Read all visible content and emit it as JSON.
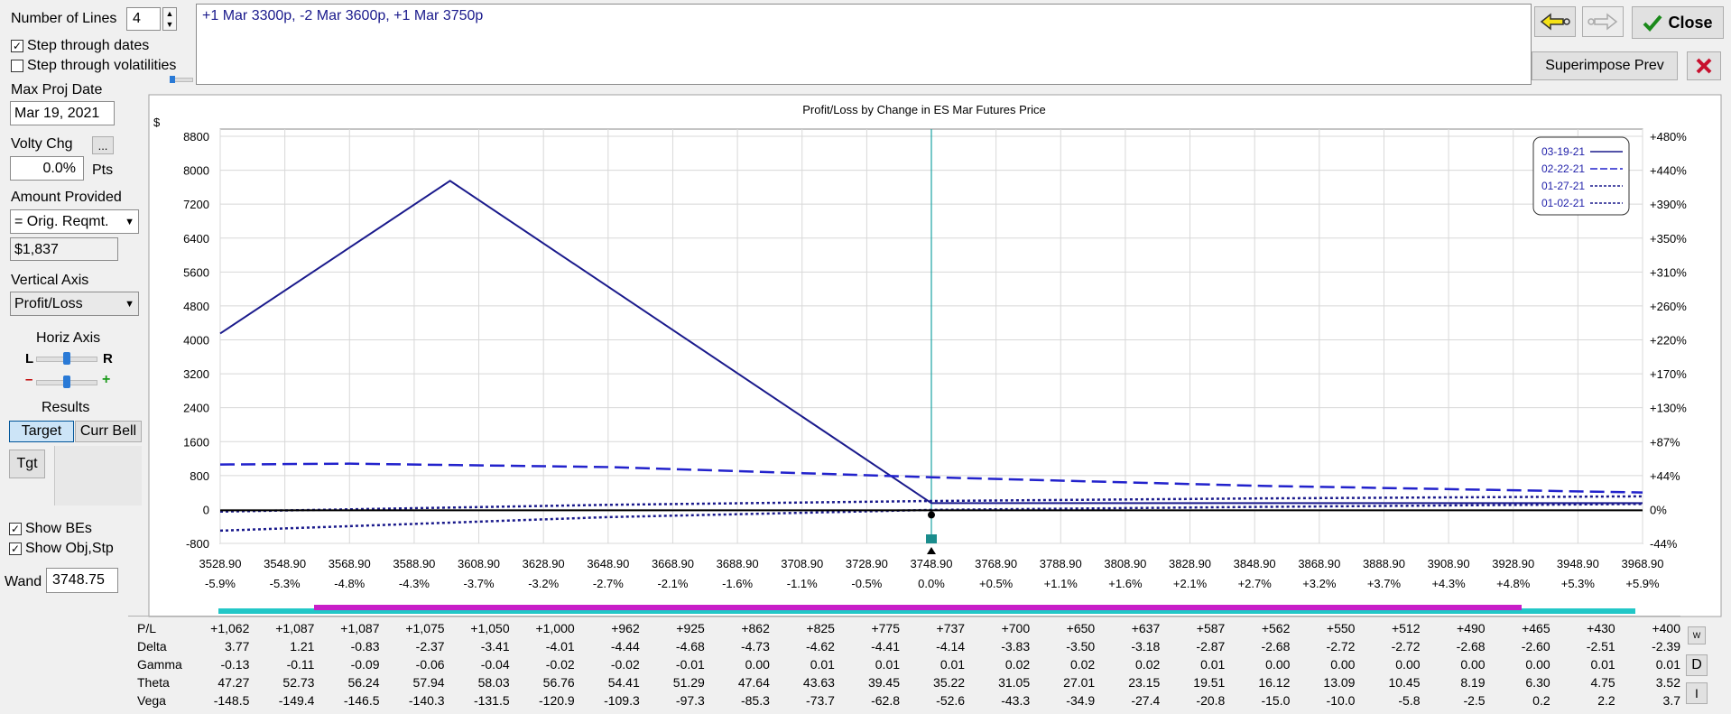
{
  "controls": {
    "number_of_lines_label": "Number of Lines",
    "number_of_lines_value": "4",
    "step_dates_label": "Step through dates",
    "step_dates_checked": true,
    "step_vols_label": "Step through volatilities",
    "step_vols_checked": false,
    "max_proj_date_label": "Max Proj Date",
    "max_proj_date_value": "Mar 19, 2021",
    "volty_chg_label": "Volty Chg",
    "volty_chg_btn": "...",
    "volty_chg_value": "0.0%",
    "volty_chg_unit": "Pts",
    "amount_provided_label": "Amount Provided",
    "amount_provided_select": "= Orig. Reqmt.",
    "amount_value": "$1,837",
    "vertical_axis_label": "Vertical Axis",
    "vertical_axis_select": "Profit/Loss",
    "horiz_axis_label": "Horiz Axis",
    "horiz_l": "L",
    "horiz_r": "R",
    "horiz_minus": "–",
    "horiz_plus": "+",
    "results_label": "Results",
    "target_btn": "Target",
    "curr_bell_btn": "Curr Bell",
    "tgt_btn": "Tgt",
    "show_bes_label": "Show BEs",
    "show_bes_checked": true,
    "show_obj_label": "Show Obj,Stp",
    "show_obj_checked": true,
    "wand_label": "Wand",
    "wand_value": "3748.75"
  },
  "position_text": "+1 Mar 3300p, -2 Mar 3600p, +1 Mar 3750p",
  "toolbar": {
    "back_icon": "arrow-left-icon",
    "forward_icon": "arrow-right-icon",
    "close_label": "Close",
    "close_icon": "checkmark-icon",
    "superimpose_label": "Superimpose Prev",
    "delete_icon": "red-x-icon"
  },
  "chart_data": {
    "type": "line",
    "title": "Profit/Loss by Change in ES Mar Futures Price",
    "yunit_label": "$",
    "x_ticks": [
      "3528.90",
      "3548.90",
      "3568.90",
      "3588.90",
      "3608.90",
      "3628.90",
      "3648.90",
      "3668.90",
      "3688.90",
      "3708.90",
      "3728.90",
      "3748.90",
      "3768.90",
      "3788.90",
      "3808.90",
      "3828.90",
      "3848.90",
      "3868.90",
      "3888.90",
      "3908.90",
      "3928.90",
      "3948.90",
      "3968.90"
    ],
    "x_pct_ticks": [
      "-5.9%",
      "-5.3%",
      "-4.8%",
      "-4.3%",
      "-3.7%",
      "-3.2%",
      "-2.7%",
      "-2.1%",
      "-1.6%",
      "-1.1%",
      "-0.5%",
      "0.0%",
      "+0.5%",
      "+1.1%",
      "+1.6%",
      "+2.1%",
      "+2.7%",
      "+3.2%",
      "+3.7%",
      "+4.3%",
      "+4.8%",
      "+5.3%",
      "+5.9%"
    ],
    "y_ticks": [
      "8800",
      "8000",
      "7200",
      "6400",
      "5600",
      "4800",
      "4000",
      "3200",
      "2400",
      "1600",
      "800",
      "0",
      "-800"
    ],
    "y2_ticks": [
      "+480%",
      "+440%",
      "+390%",
      "+350%",
      "+310%",
      "+260%",
      "+220%",
      "+170%",
      "+130%",
      "+87%",
      "+44%",
      "0%",
      "-44%"
    ],
    "xlim": [
      3528.9,
      3968.9
    ],
    "ylim": [
      -800,
      8800
    ],
    "current_price": 3748.9,
    "legend_placement": "top-right",
    "series": [
      {
        "name": "03-19-21",
        "style": "solid",
        "color": "#1a1a8c",
        "x": [
          3528.9,
          3600,
          3748.9,
          3968.9
        ],
        "y": [
          4150,
          7750,
          150,
          150
        ]
      },
      {
        "name": "02-22-21",
        "style": "longdash",
        "color": "#2222cc",
        "x": [
          3528.9,
          3568.9,
          3648.9,
          3748.9,
          3848.9,
          3968.9
        ],
        "y": [
          1060,
          1080,
          1000,
          760,
          560,
          400
        ]
      },
      {
        "name": "01-27-21",
        "style": "dotted",
        "color": "#1a1a8c",
        "x": [
          3528.9,
          3648.9,
          3748.9,
          3848.9,
          3968.9
        ],
        "y": [
          -50,
          110,
          200,
          260,
          310
        ]
      },
      {
        "name": "01-02-21",
        "style": "dotted",
        "color": "#1a1a8c",
        "x": [
          3528.9,
          3648.9,
          3748.9,
          3848.9,
          3968.9
        ],
        "y": [
          -500,
          -180,
          -10,
          60,
          130
        ]
      },
      {
        "name": "",
        "style": "solid-black",
        "color": "#000000",
        "x": [
          3528.9,
          3968.9
        ],
        "y": [
          -20,
          -20
        ]
      }
    ]
  },
  "greeks": {
    "rows": [
      {
        "label": "P/L",
        "values": [
          "+1,062",
          "+1,087",
          "+1,087",
          "+1,075",
          "+1,050",
          "+1,000",
          "+962",
          "+925",
          "+862",
          "+825",
          "+775",
          "+737",
          "+700",
          "+650",
          "+637",
          "+587",
          "+562",
          "+550",
          "+512",
          "+490",
          "+465",
          "+430",
          "+400"
        ]
      },
      {
        "label": "Delta",
        "values": [
          "3.77",
          "1.21",
          "-0.83",
          "-2.37",
          "-3.41",
          "-4.01",
          "-4.44",
          "-4.68",
          "-4.73",
          "-4.62",
          "-4.41",
          "-4.14",
          "-3.83",
          "-3.50",
          "-3.18",
          "-2.87",
          "-2.68",
          "-2.72",
          "-2.72",
          "-2.68",
          "-2.60",
          "-2.51",
          "-2.39"
        ]
      },
      {
        "label": "Gamma",
        "values": [
          "-0.13",
          "-0.11",
          "-0.09",
          "-0.06",
          "-0.04",
          "-0.02",
          "-0.02",
          "-0.01",
          "0.00",
          "0.01",
          "0.01",
          "0.01",
          "0.02",
          "0.02",
          "0.02",
          "0.01",
          "0.00",
          "0.00",
          "0.00",
          "0.00",
          "0.00",
          "0.01",
          "0.01"
        ]
      },
      {
        "label": "Theta",
        "values": [
          "47.27",
          "52.73",
          "56.24",
          "57.94",
          "58.03",
          "56.76",
          "54.41",
          "51.29",
          "47.64",
          "43.63",
          "39.45",
          "35.22",
          "31.05",
          "27.01",
          "23.15",
          "19.51",
          "16.12",
          "13.09",
          "10.45",
          "8.19",
          "6.30",
          "4.75",
          "3.52"
        ]
      },
      {
        "label": "Vega",
        "values": [
          "-148.5",
          "-149.4",
          "-146.5",
          "-140.3",
          "-131.5",
          "-120.9",
          "-109.3",
          "-97.3",
          "-85.3",
          "-73.7",
          "-62.8",
          "-52.6",
          "-43.3",
          "-34.9",
          "-27.4",
          "-20.8",
          "-15.0",
          "-10.0",
          "-5.8",
          "-2.5",
          "0.2",
          "2.2",
          "3.7"
        ]
      }
    ],
    "side_buttons": [
      "W",
      "D",
      "I"
    ]
  }
}
